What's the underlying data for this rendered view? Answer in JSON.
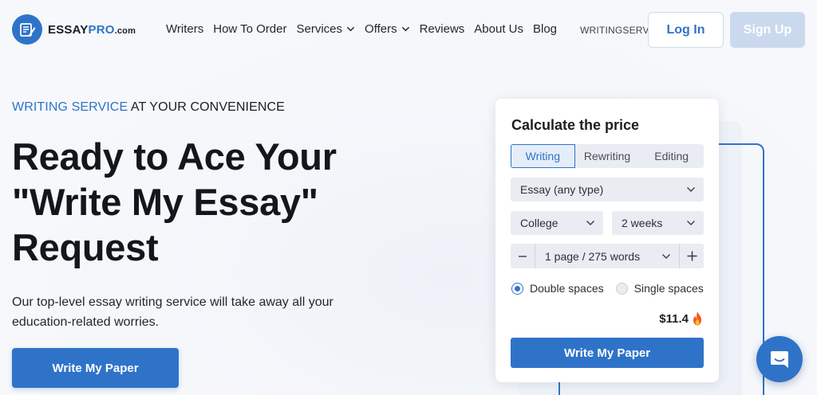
{
  "brand": {
    "name_main": "ESSAY",
    "name_accent": "PRO",
    "name_suffix": ".com",
    "accent_color": "#2f73c9"
  },
  "nav": {
    "items": [
      {
        "label": "Writers",
        "has_dropdown": false
      },
      {
        "label": "How To Order",
        "has_dropdown": false
      },
      {
        "label": "Services",
        "has_dropdown": true
      },
      {
        "label": "Offers",
        "has_dropdown": true
      },
      {
        "label": "Reviews",
        "has_dropdown": false
      },
      {
        "label": "About Us",
        "has_dropdown": false
      },
      {
        "label": "Blog",
        "has_dropdown": false
      }
    ],
    "promo_code": "WRITINGSERV",
    "login_label": "Log In",
    "signup_label": "Sign Up"
  },
  "hero": {
    "eyebrow_accent": "WRITING SERVICE",
    "eyebrow_rest": " AT YOUR CONVENIENCE",
    "title": "Ready to Ace Your \"Write My Essay\" Request",
    "description": "Our top-level essay writing service will take away all your education-related worries.",
    "cta_label": "Write My Paper"
  },
  "calculator": {
    "title": "Calculate the price",
    "tabs": [
      {
        "label": "Writing",
        "active": true
      },
      {
        "label": "Rewriting",
        "active": false
      },
      {
        "label": "Editing",
        "active": false
      }
    ],
    "paper_type": "Essay (any type)",
    "academic_level": "College",
    "deadline": "2 weeks",
    "pages": "1 page / 275 words",
    "spacing_options": [
      {
        "label": "Double spaces",
        "checked": true
      },
      {
        "label": "Single spaces",
        "checked": false
      }
    ],
    "price": "$11.4",
    "cta_label": "Write My Paper"
  },
  "icons": {
    "logo": "essay-pen-icon",
    "dropdown": "chevron-down-icon",
    "price_badge": "fire-icon",
    "chat": "chat-bubble-icon"
  }
}
